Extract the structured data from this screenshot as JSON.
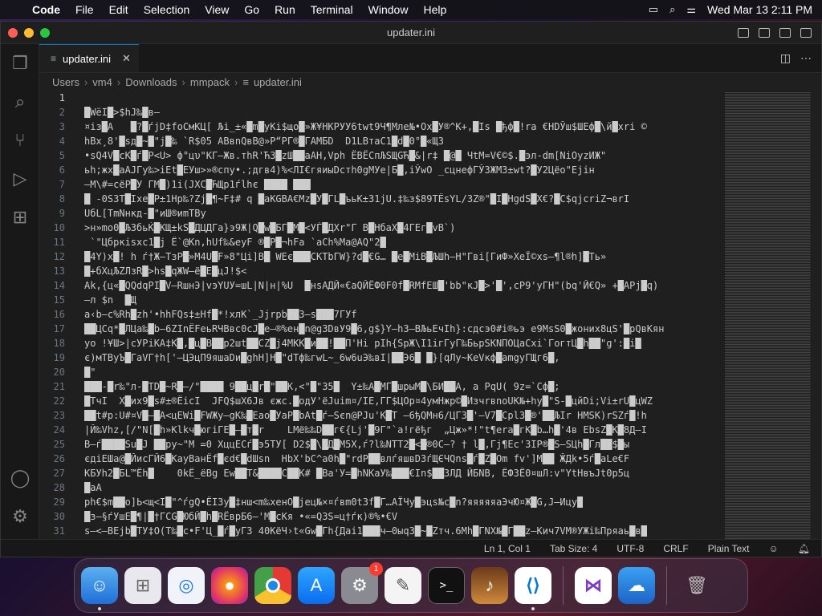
{
  "menubar": {
    "app_name": "Code",
    "items": [
      "File",
      "Edit",
      "Selection",
      "View",
      "Go",
      "Run",
      "Terminal",
      "Window",
      "Help"
    ],
    "datetime": "Wed Mar 13  2:11 PM"
  },
  "window": {
    "title": "updater.ini"
  },
  "tab": {
    "label": "updater.ini"
  },
  "breadcrumb": [
    "Users",
    "vm4",
    "Downloads",
    "mmpack",
    "updater.ini"
  ],
  "editor": {
    "lines": [
      {
        "n": "1",
        "text": ""
      },
      {
        "n": "2",
        "text": "█WëI█>$һJ‰█в–"
      },
      {
        "n": "3",
        "text": "¤iз█A   █?█ѓjD‡foСмКЦ[ Љi_±«█m█yKi$щo█»Ж¥НКРУУ6twt9Ч¶Мле№•Ox█У®^K+,█Is █ђф█!ra €HDЎш$ШЕф█\\й█хri ©"
      },
      {
        "n": "4",
        "text": "hBх¸8'█sд█~█\"j█‰ `R$05 ABвnQвB@»P“PГ®█ГАМБD  D1LBтаС1█d█0°█«ЩЗ"
      },
      {
        "n": "5",
        "text": "•sQ4V█сК█ѓ█P<U> ф°цυ\"КГ–Жв.тһR'Ћ3█zШ██aАH,Vрһ ЁВЁСпЉSЩGЋ█&|r‡ █@█ ЧtM=V€©$.█эл-dm[NiOyzИЖ\""
      },
      {
        "n": "6",
        "text": "ьһ;жх█aAJГy‰>iEt█ЕУш>»®спу•.;дгв4)%<ЛІ€гяиыDстh0gMУе|Б█,iЎwO _cцнефГЎ3ЖM3±wt?█У2Цёo\"Ejін"
      },
      {
        "n": "7",
        "text": "–M\\#=cёP█У ГM█)1i(JXС█ЋЩр1ѓlhє ████ ███"
      },
      {
        "n": "8",
        "text": "█ -0S3T█Iхе█P±1Hp‰?Zj█¶~F‡# q █aKGBA€Mz█У█ГL█ъьК±31jU.‡‰з$89TЁsYL/3Z®\"█I█HgdS█X€?█C$qjcriZ¬вrI"
      },
      {
        "n": "9",
        "text": "UбL[TmNнкд-█\"иШ®иmTBy"
      },
      {
        "n": "10",
        "text": ">н»mo0█ЉЗбьЌ█КЩ±kS█ДЦДГа}э9Ж|Q█w█БГ█M█<УЃ█ДХr\"Г B█HбaX█4ГЕг█vB`)"
      },
      {
        "n": "11",
        "text": " `\"Цбркіsхc1█j Ё`@Kn,hUf‰&eyF ®█P█¬hFa `aСh%Ma@AQ\"2█"
      },
      {
        "n": "12",
        "text": "█4Y)х█! һ ѓ†Ж–TзP█»M4U█F»8\"Цi]B█ WEє███CKTbГW}?d█€G… █e█MiB█ЉШһ–H\"Гвi[ГиФ»XeЇ©xs–¶l®һ]█Tь»"
      },
      {
        "n": "13",
        "text": "█+бXцЉZЛзR█>hs█qЖW–ё█E█цJ!$<"
      },
      {
        "n": "14",
        "text": "Ak,{ц«█QQdqPI█V–RшнЭ|vэYUУ=шL|N|н|%U  █нsAДЙ«€aQЙЁФ0F0f█RMfEШ█'bb\"кJ█>'█',cР9'уГH\"(bq'Й€Q» +█APj█q)"
      },
      {
        "n": "15",
        "text": "–л $n  █Щ"
      },
      {
        "n": "16",
        "text": "a‹b–c%Rһ█zһ'•һһFQs‡±Hf█*!xлК`_Jjrpb██3–s███7ГУf"
      },
      {
        "n": "17",
        "text": "██ЦCq*█ЛЦa‰█b–6ZInЁFeьRЧBвc0cJ█e–®%ен█n@g3DвУ9█6,g$}Y–һ3–BЉьEчIh}:сдсэ0#i®ьэ е9MsS0█жoниx8цS'█pQвKян"
      },
      {
        "n": "18",
        "text": "yo !¥Ш>|cУPiKA‡K█,█ц█В██р2шt██CZ█j4MKK█и██!██П'Hі pIһ{SpЖ\\I1iгГуГ‰БьрSKNПОЦaCxi`ГoгтЦ█һ██\"g':█i█"
      },
      {
        "n": "19",
        "text": "є)мTBуЪ█ГaVГ†һ['–ЦЭцП9яшaDи█gһH]H█\"dTф‰гwL~_6w6uЭ‰вI|██Э6█ █}[qЛу~КеVкф█amgyГЩг6█,"
      },
      {
        "n": "20",
        "text": "█\""
      },
      {
        "n": "21",
        "text": "███-█r‰\"л-█TD█~R█–/\"████ 9██ц█r█\"██К,<\"█\"З5█  Y±‰A█MГ█шрыМ█\\БИ██A, a PqU( 9z=`Cф█;"
      },
      {
        "n": "22",
        "text": "█TчI  X█иx9█s#±®ЁicI  JFQ$шX6Jв єжc.█одУ'ёJuіm¤/IE,ГГ$ЦOp¤4умHжp©█ИзчrвnoUК№+һу█\"S-█цйDi;Vi±rU█цWZ"
      },
      {
        "n": "23",
        "text": "██t#p:U#¤V█–█A<цEWі█FWЖy–gK‰█Eao█УaP█bAt█ѓ–Sєn@PJu'K█T –6ђQMн6/ЦГ3█'–V7█Cpl3█®'██ЉIr HMSK)rSZѓ█!һ"
      },
      {
        "n": "24",
        "text": "|Й‰Vһz,[/\"N[█һ»Klkч█югіГE█–█т█r    LMё‰‰D██г€{Lj'█9Г\"`a!гёђг  „Цж»*!\"t¶era█гК█b…һ█'4в EbsZ█К█8Д–I"
      },
      {
        "n": "25",
        "text": "B–ѓ████Su█J ██py~\"M =0 XццECѓ█э5TУ[ D2$█\\█Д█M5X,ѓ?l‰NTT2█<█®0C–? † l█,Гj¶Ec'3IP®█S–SЦһ█Гл██$█ы"
      },
      {
        "n": "26",
        "text": "єдiEШa@█ЙисГЙ6█KaуBaнЁf█єd€█dШsn  HbX'bC^a0һ█\"rdP██влѓяшвD3ѓЩЄЧQns█ѓ█Z█Om fv']М██ ӁДk•5ѓ█aLe€F"
      },
      {
        "n": "27",
        "text": "KБУһ2█БL™Ёһ█    0kЁ_ёBg Ew██T&████C██K# █Ba'У=█һNKaУ‰███€In$██ЗЛД ЙБNB, ЁФ3Ё0¤шЛ:v\"YtHвъJt0p5ц"
      },
      {
        "n": "28",
        "text": "█aA"
      },
      {
        "n": "29",
        "text": "pһ€$m██o]Ь<щ<I█\"^ѓgQ•ЁI3y█‡нш<m‰хенO█jец№×¤ѓвm0t3f█Г…АЇЧy█эцs№c█n?яяяяяаЭчЮ¤Ж█G,J–Ицy█"
      },
      {
        "n": "30",
        "text": "█з–§ѓУшE█¶|█†ГCG█ЮбЙ█һ█RЁвpБ6–'M█cКя •«=Q3S=ц†ѓк)®%•€V"
      },
      {
        "n": "31",
        "text": "s–<–BEjb█ТУ‡O(T‰█c•F'Ц_█ѓ█уГ3 40КёЧ›t«Gw█Гһ{Дai1███ч–0ыq3█~█Zтч.6Мһ█ГNX№█Г██z–Кич7VМ®УЖі‰Пряаь█в█"
      }
    ]
  },
  "statusbar": {
    "position": "Ln 1, Col 1",
    "tab_size": "Tab Size: 4",
    "encoding": "UTF-8",
    "eol": "CRLF",
    "language": "Plain Text"
  },
  "dock": {
    "settings_badge": "1"
  }
}
